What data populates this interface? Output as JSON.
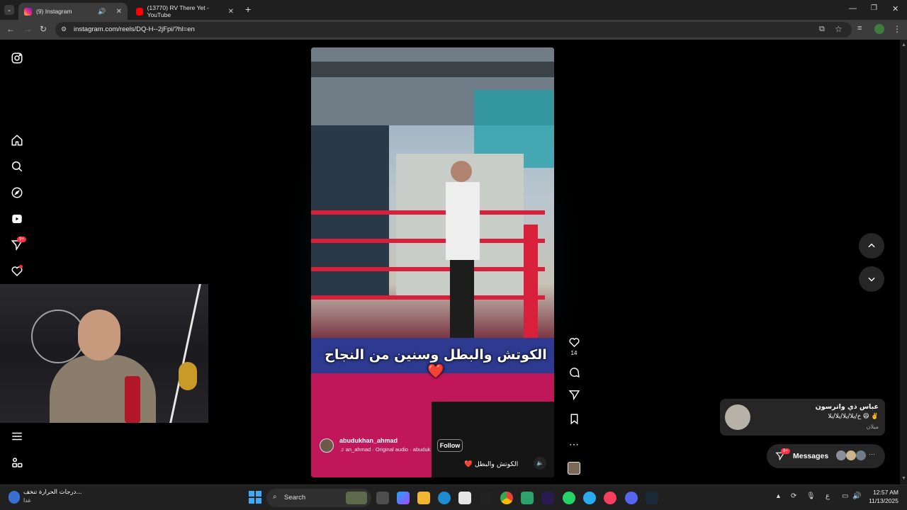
{
  "browser": {
    "tabs": [
      {
        "title": "(9) Instagram",
        "active": true
      },
      {
        "title": "(13770) RV There Yet - YouTube",
        "active": false
      }
    ],
    "new_tab": "+",
    "url": "instagram.com/reels/DQ-H--2jFpi/?hl=en"
  },
  "reel": {
    "caption": "الكوتش والبطل وسنين من النجاح ❤️",
    "username": "abudukhan_ahmad",
    "audio": "an_ahmad · Original audio · abuduk",
    "follow_label": "Follow",
    "description": "❤️ الكوتش والبطل",
    "like_count": "14"
  },
  "notification": {
    "name": "عباس ذي واترسون",
    "message": "خ/يلا/يلا/يلا/يلا 😆 ✌️",
    "sub": "ميلان"
  },
  "messages": {
    "label": "Messages",
    "badge": "9+"
  },
  "sidebar": {
    "notifications_badge": "9+"
  },
  "taskbar": {
    "weather_text": "درجات الحرارة تنخف...",
    "weather_sub": "غدا",
    "search_placeholder": "Search",
    "lang": "ع",
    "time": "12:57 AM",
    "date": "11/13/2025"
  },
  "colors": {
    "accent": "#ff3040",
    "chrome_bg": "#3c3c3c",
    "taskbar_bg": "#202020"
  }
}
